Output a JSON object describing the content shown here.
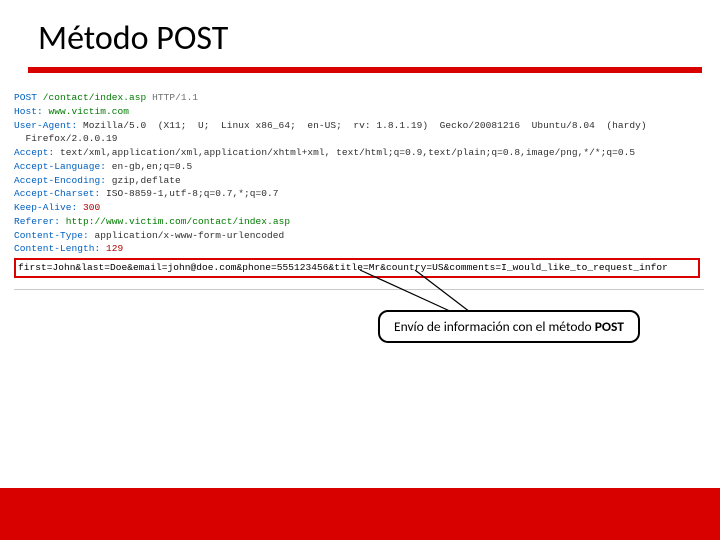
{
  "slide": {
    "title": "Método POST",
    "callout": "Envío de información con el método POST"
  },
  "http": {
    "method": "POST",
    "path": "/contact/index.asp",
    "protocol": "HTTP/1.1",
    "headers": {
      "host_name": "Host:",
      "host_val": "www.victim.com",
      "ua_name": "User-Agent:",
      "ua_val": "Mozilla/5.0  (X11;  U;  Linux x86_64;  en-US;  rv: 1.8.1.19)  Gecko/20081216  Ubuntu/8.04  (hardy)",
      "ua_val2": "Firefox/2.0.0.19",
      "accept_name": "Accept:",
      "accept_val": "text/xml,application/xml,application/xhtml+xml, text/html;q=0.9,text/plain;q=0.8,image/png,*/*;q=0.5",
      "acclang_name": "Accept-Language:",
      "acclang_val": "en-gb,en;q=0.5",
      "accenc_name": "Accept-Encoding:",
      "accenc_val": "gzip,deflate",
      "acccs_name": "Accept-Charset:",
      "acccs_val": "ISO-8859-1,utf-8;q=0.7,*;q=0.7",
      "keep_name": "Keep-Alive:",
      "keep_val": "300",
      "ref_name": "Referer:",
      "ref_val": "http://www.victim.com/contact/index.asp",
      "ct_name": "Content-Type:",
      "ct_val": "application/x-www-form-urlencoded",
      "cl_name": "Content-Length:",
      "cl_val": "129"
    },
    "body": "first=John&last=Doe&email=john@doe.com&phone=555123456&title=Mr&country=US&comments=I_would_like_to_request_infor"
  }
}
